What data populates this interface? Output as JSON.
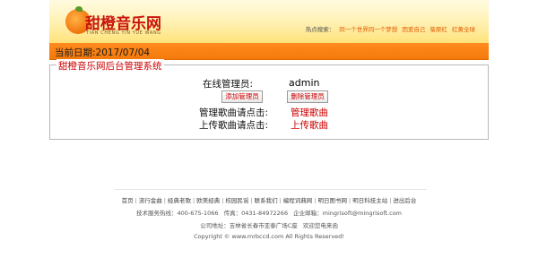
{
  "header": {
    "logo_text": "甜橙音乐网",
    "logo_sub": "TIAN CHENG YIN YUE WANG",
    "hot_label": "热点搜索：",
    "hot_links": [
      "同一个世界同一个梦想",
      "因爱自己",
      "菊原红",
      "红黄全球"
    ]
  },
  "datebar": {
    "label": "当前日期:",
    "date": "2017/07/04"
  },
  "admin": {
    "legend": "甜橙音乐网后台管理系统",
    "online_label": "在线管理员:",
    "online_value": "admin",
    "add_button": "添加管理员",
    "delete_button": "删除管理员",
    "manage_label": "管理歌曲请点击:",
    "manage_link": "管理歌曲",
    "upload_label": "上传歌曲请点击:",
    "upload_link": "上传歌曲"
  },
  "footer": {
    "nav": [
      "首页",
      "流行金曲",
      "经典老歌",
      "欧美经典",
      "校园民谣",
      "联系我们",
      "编程词典网",
      "明日图书网",
      "明日科技主站",
      "进出后台"
    ],
    "separator": "|",
    "service_phone": "技术服务热线：400-675-1066",
    "fax": "传真：0431-84972266",
    "email": "企业邮箱：mingrisoft@mingrisoft.com",
    "address": "公司地址：吉林省长春市亚泰广场C座",
    "welcome": "欢迎您电来函",
    "copyright": "Copyright © www.mrbccd.com All Rights Reserved!"
  }
}
